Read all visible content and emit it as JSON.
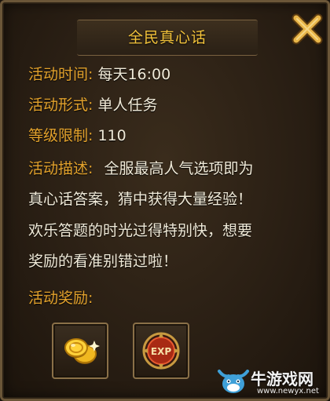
{
  "dialog": {
    "title": "全民真心话",
    "close_icon": "close-x-icon"
  },
  "info": {
    "time_label": "活动时间",
    "time_sep": ":",
    "time_value": "每天16:00",
    "form_label": "活动形式",
    "form_sep": ":",
    "form_value": "单人任务",
    "level_label": "等级限制",
    "level_sep": ":",
    "level_value": "110",
    "desc_label": "活动描述",
    "desc_sep": ":",
    "desc_line1": "全服最高人气选项即为",
    "desc_line2": "真心话答案，猜中获得大量经验！",
    "desc_line3": "欢乐答题的时光过得特别快，想要",
    "desc_line4": "奖励的看准别错过啦！",
    "reward_label": "活动奖励",
    "reward_sep": ":"
  },
  "rewards": [
    {
      "icon": "gold-coins-icon"
    },
    {
      "icon": "exp-orb-icon",
      "text": "EXP"
    }
  ],
  "watermark": {
    "text": "牛游戏网",
    "url": "www.newyx.net"
  },
  "colors": {
    "title": "#f2c23a",
    "label": "#e3a22c",
    "text": "#f0ead8",
    "frame": "#6b5638"
  }
}
